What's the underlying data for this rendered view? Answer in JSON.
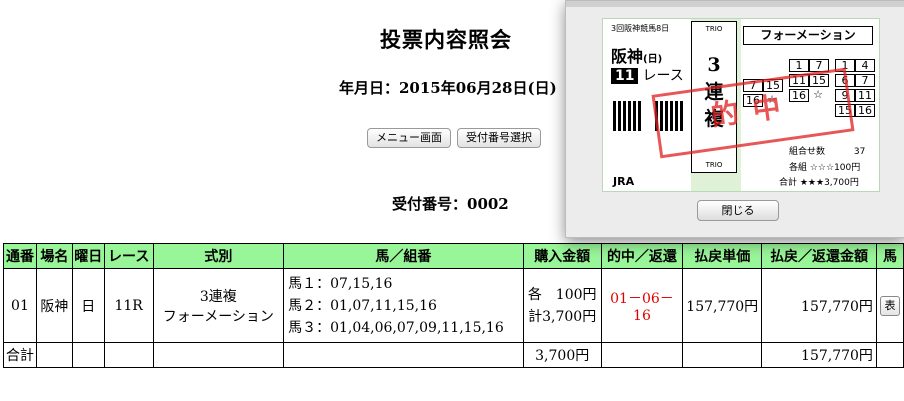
{
  "header": {
    "title": "投票内容照会",
    "date_line": "年月日：2015年06月28日(日)",
    "menu_button": "メニュー画面",
    "select_button": "受付番号選択",
    "receipt_number": "受付番号：0002"
  },
  "table": {
    "headers": [
      "通番",
      "場名",
      "曜日",
      "レース",
      "式別",
      "馬／組番",
      "購入金額",
      "的中／返還",
      "払戻単価",
      "払戻／返還金額",
      "馬"
    ],
    "row": {
      "seq": "01",
      "venue": "阪神",
      "day": "日",
      "race": "11R",
      "bet_type": "3連複",
      "bet_method": "フォーメーション",
      "combo_1": "馬１：07,15,16",
      "combo_2": "馬２：01,07,11,15,16",
      "combo_3": "馬３：01,04,06,07,09,11,15,16",
      "amount_each": "各　100円",
      "amount_total": "計3,700円",
      "hit_line_1": "01－06－",
      "hit_line_2": "16",
      "unit_payout": "157,770円",
      "payout": "157,770円",
      "detail_button": "表"
    },
    "total_row": {
      "label": "合計",
      "amount": "3,700円",
      "payout": "157,770円"
    },
    "hit_color": "#e00000",
    "header_color": "#98f598"
  },
  "popup": {
    "ticket": {
      "venue_line": "3回阪神競馬8日",
      "place": "阪神",
      "day": "(日)",
      "race_number": "11",
      "race_label": "レース",
      "trio_top": "TRIO",
      "trio_bottom": "TRIO",
      "bet_type_digit": "3",
      "bet_type_chars": [
        "連",
        "複"
      ],
      "formation_label": "フォーメーション",
      "horse_col_1": [
        "7",
        "16"
      ],
      "horse_col_2": [
        "15",
        "☆"
      ],
      "horse_col_3": [
        "1",
        "11",
        "16"
      ],
      "horse_col_4": [
        "7",
        "15",
        "☆"
      ],
      "horse_col_5": [
        "1",
        "6",
        "9",
        "15"
      ],
      "horse_col_6": [
        "4",
        "7",
        "11",
        "16"
      ],
      "count_label": "組合せ数",
      "count_value": "37",
      "each_line": "各組 ☆☆☆100円",
      "total_line": "合計 ★★★3,700円",
      "jra": "JRA",
      "stamp": "的中"
    },
    "close_button": "閉じる"
  }
}
